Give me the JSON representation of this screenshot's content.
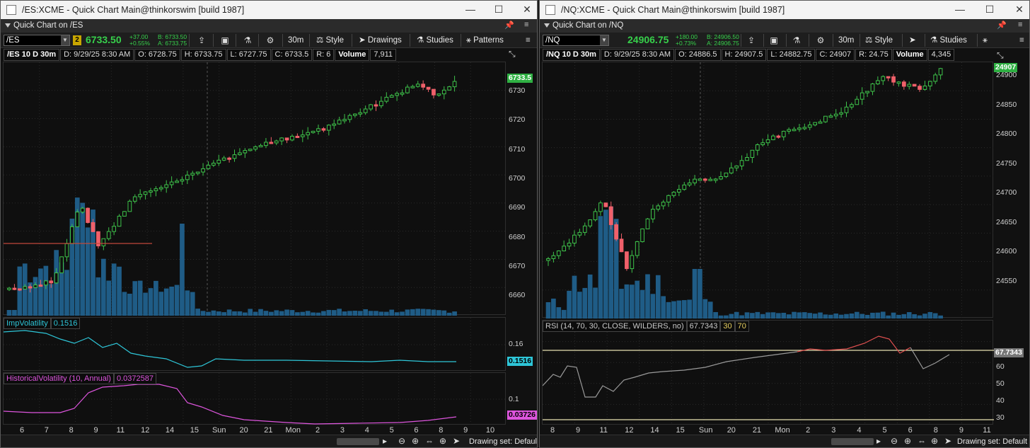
{
  "left": {
    "window_title": "/ES:XCME - Quick Chart Main@thinkorswim [build 1987]",
    "header": "Quick Chart on /ES",
    "symbol": "/ES",
    "badge": "2",
    "last_price": "6733.50",
    "change_abs": "+37.00",
    "change_pct": "+0.55%",
    "bid": "B: 6733.50",
    "ask": "A: 6733.75",
    "timeframe": "30m",
    "style_label": "Style",
    "drawings_label": "Drawings",
    "studies_label": "Studies",
    "patterns_label": "Patterns",
    "info": [
      "/ES 10 D 30m",
      "D: 9/29/25 8:30 AM",
      "O: 6728.75",
      "H: 6733.75",
      "L: 6727.75",
      "C: 6733.5",
      "R: 6",
      "Volume",
      "7,911"
    ],
    "price_tag": "6733.5",
    "price_axis": [
      "6730",
      "6720",
      "6710",
      "6700",
      "6690",
      "6680",
      "6670",
      "6660"
    ],
    "ivol_label": "ImpVolatility",
    "ivol_value": "0.1516",
    "ivol_axis": [
      "0.16"
    ],
    "ivol_tag": "0.1516",
    "hvol_label": "HistoricalVolatility (10, Annual)",
    "hvol_value": "0.0372587",
    "hvol_axis": [
      "0.1"
    ],
    "hvol_tag": "0.03726",
    "time_labels": [
      "6",
      "7",
      "8",
      "9",
      "11",
      "12",
      "14",
      "15",
      "Sun",
      "20",
      "21",
      "Mon",
      "2",
      "3",
      "4",
      "5",
      "6",
      "8",
      "9",
      "10"
    ],
    "status": "Drawing set: Default",
    "colors": {
      "up": "#3ec24a",
      "down": "#f0606a",
      "volume": "#1f5c86",
      "ivol": "#2ec6d8",
      "hvol": "#dd55dd",
      "tag_up": "#2fb043",
      "ref": "#c0483a"
    }
  },
  "right": {
    "window_title": "/NQ:XCME - Quick Chart Main@thinkorswim [build 1987]",
    "header": "Quick Chart on /NQ",
    "symbol": "/NQ",
    "last_price": "24906.75",
    "change_abs": "+180.00",
    "change_pct": "+0.73%",
    "bid": "B: 24906.50",
    "ask": "A: 24906.75",
    "timeframe": "30m",
    "style_label": "Style",
    "studies_label": "Studies",
    "info": [
      "/NQ 10 D 30m",
      "D: 9/29/25 8:30 AM",
      "O: 24886.5",
      "H: 24907.5",
      "L: 24882.75",
      "C: 24907",
      "R: 24.75",
      "Volume",
      "4,345"
    ],
    "price_tag": "24907",
    "price_axis": [
      "24900",
      "24850",
      "24800",
      "24750",
      "24700",
      "24650",
      "24600",
      "24550"
    ],
    "rsi_label": "RSI (14, 70, 30, CLOSE, WILDERS, no)",
    "rsi_value": "67.7343",
    "rsi_os": "30",
    "rsi_ob": "70",
    "rsi_axis": [
      "60",
      "50",
      "40",
      "30"
    ],
    "rsi_tag": "67.7343",
    "time_labels": [
      "8",
      "9",
      "11",
      "12",
      "14",
      "15",
      "Sun",
      "20",
      "21",
      "Mon",
      "2",
      "3",
      "4",
      "5",
      "6",
      "8",
      "9",
      "11"
    ],
    "status": "Drawing set: Default",
    "colors": {
      "up": "#3ec24a",
      "down": "#f0606a",
      "volume": "#1f5c86",
      "rsi": "#9a9a9a",
      "rsi_ob": "#e05050",
      "tag_up": "#2fb043",
      "rsi_line": "#e8e0b0"
    }
  }
}
